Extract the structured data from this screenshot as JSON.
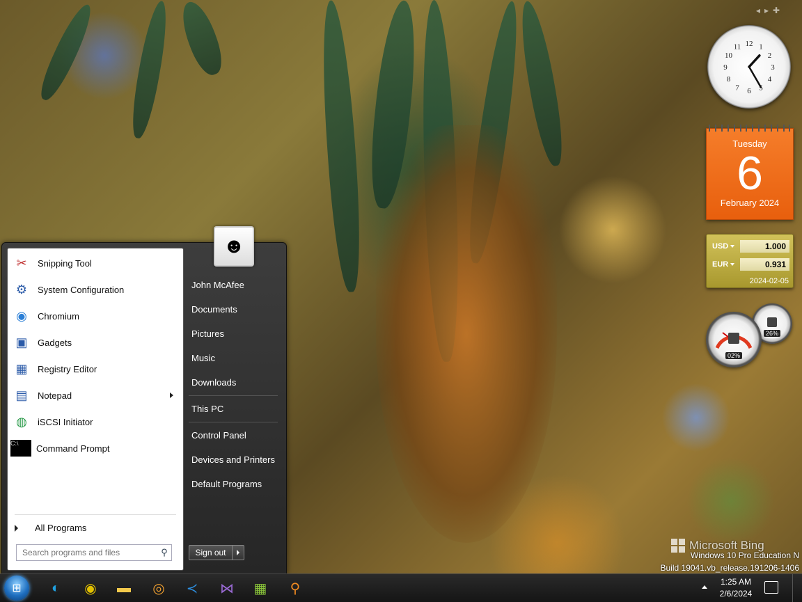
{
  "start_menu": {
    "programs": [
      {
        "label": "Snipping Tool",
        "icon": "scissors-icon",
        "glyph": "✂"
      },
      {
        "label": "System Configuration",
        "icon": "system-config-icon",
        "glyph": "⚙"
      },
      {
        "label": "Chromium",
        "icon": "chromium-icon",
        "glyph": "◉"
      },
      {
        "label": "Gadgets",
        "icon": "gadgets-icon",
        "glyph": "▣"
      },
      {
        "label": "Registry Editor",
        "icon": "registry-icon",
        "glyph": "▦"
      },
      {
        "label": "Notepad",
        "icon": "notepad-icon",
        "glyph": "▤"
      },
      {
        "label": "iSCSI Initiator",
        "icon": "globe-icon",
        "glyph": "◍"
      },
      {
        "label": "Command Prompt",
        "icon": "cmd-icon",
        "glyph": "C:\\"
      }
    ],
    "all_programs": "All Programs",
    "search_placeholder": "Search programs and files",
    "right_items": {
      "user": "John McAfee",
      "documents": "Documents",
      "pictures": "Pictures",
      "music": "Music",
      "downloads": "Downloads",
      "this_pc": "This PC",
      "control_panel": "Control Panel",
      "devices": "Devices and Printers",
      "default_programs": "Default Programs"
    },
    "sign_out": "Sign out"
  },
  "gadgets": {
    "clock": {
      "hour": 1,
      "minute": 25
    },
    "calendar": {
      "weekday": "Tuesday",
      "day": "6",
      "month_year": "February 2024"
    },
    "currency": {
      "from_code": "USD",
      "from_value": "1.000",
      "to_code": "EUR",
      "to_value": "0.931",
      "date": "2024-02-05"
    },
    "cpu_meter": {
      "cpu": "02%",
      "memory": "26%"
    },
    "clock_numbers": [
      "12",
      "1",
      "2",
      "3",
      "4",
      "5",
      "6",
      "7",
      "8",
      "9",
      "10",
      "11"
    ]
  },
  "watermark": {
    "bing": "Microsoft Bing",
    "edition": "Windows 10 Pro Education N",
    "build": "Build 19041.vb_release.191206-1406"
  },
  "taskbar": {
    "apps": [
      {
        "name": "edge-icon",
        "glyph": "◐",
        "color": "#1fa0e0"
      },
      {
        "name": "chrome-icon",
        "glyph": "◉",
        "color": "#e2c000"
      },
      {
        "name": "file-explorer-icon",
        "glyph": "▬",
        "color": "#f2c94c"
      },
      {
        "name": "chromium-icon",
        "glyph": "◎",
        "color": "#f0a030"
      },
      {
        "name": "vscode-icon",
        "glyph": "≺",
        "color": "#2d8fe0"
      },
      {
        "name": "visual-studio-icon",
        "glyph": "⋈",
        "color": "#9b6bd6"
      },
      {
        "name": "notepad-plus-icon",
        "glyph": "▦",
        "color": "#8ac43a"
      },
      {
        "name": "search-app-icon",
        "glyph": "⚲",
        "color": "#f08a20"
      }
    ],
    "time": "1:25 AM",
    "date": "2/6/2024"
  }
}
